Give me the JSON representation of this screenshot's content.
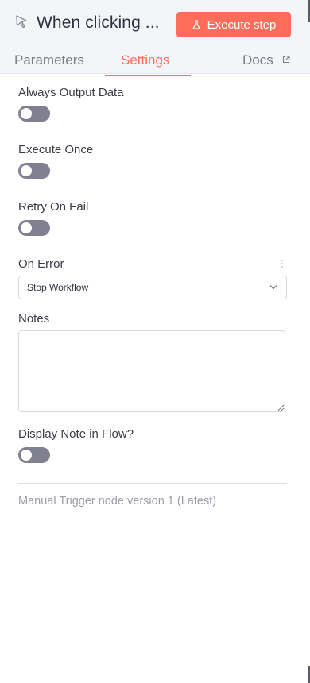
{
  "header": {
    "title": "When clicking ...",
    "execute_label": "Execute step",
    "icons": {
      "node": "cursor-arrow-icon",
      "execute": "flask-icon",
      "docs_link": "external-link-icon"
    },
    "accent_color": "#ff6d5a"
  },
  "tabs": {
    "parameters": "Parameters",
    "settings": "Settings",
    "docs": "Docs",
    "active": "Settings"
  },
  "settings": {
    "always_output": {
      "label": "Always Output Data",
      "enabled": false
    },
    "execute_once": {
      "label": "Execute Once",
      "enabled": false
    },
    "retry_on_fail": {
      "label": "Retry On Fail",
      "enabled": false
    },
    "on_error": {
      "label": "On Error",
      "value": "Stop Workflow"
    },
    "notes": {
      "label": "Notes",
      "value": ""
    },
    "display_note": {
      "label": "Display Note in Flow?",
      "enabled": false
    }
  },
  "footer": {
    "version": "Manual Trigger node version 1 (Latest)"
  }
}
